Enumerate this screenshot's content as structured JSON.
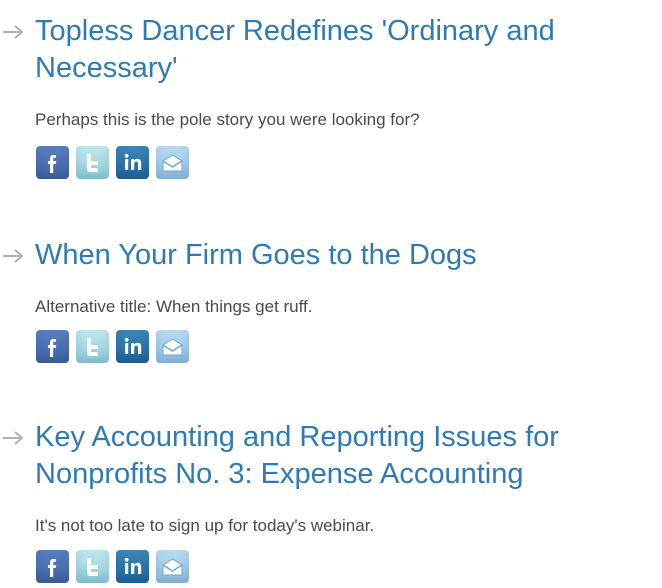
{
  "articles": [
    {
      "title": "Topless Dancer Redefines 'Ordinary and Necessary'",
      "summary": "Perhaps this is the pole story you were looking for?"
    },
    {
      "title": "When Your Firm Goes to the Dogs",
      "summary": "Alternative title: When things get ruff."
    },
    {
      "title": "Key Accounting and Reporting Issues for Nonprofits No. 3: Expense Accounting",
      "summary": "It's not too late to sign up for today's webinar."
    }
  ],
  "icons": {
    "arrow": "arrow-right-icon",
    "share": [
      "facebook-icon",
      "twitter-icon",
      "linkedin-icon",
      "email-icon"
    ]
  },
  "colors": {
    "title": "#2f7ab5",
    "summary": "#4a4a4a",
    "arrow": "#b0b0b0"
  }
}
